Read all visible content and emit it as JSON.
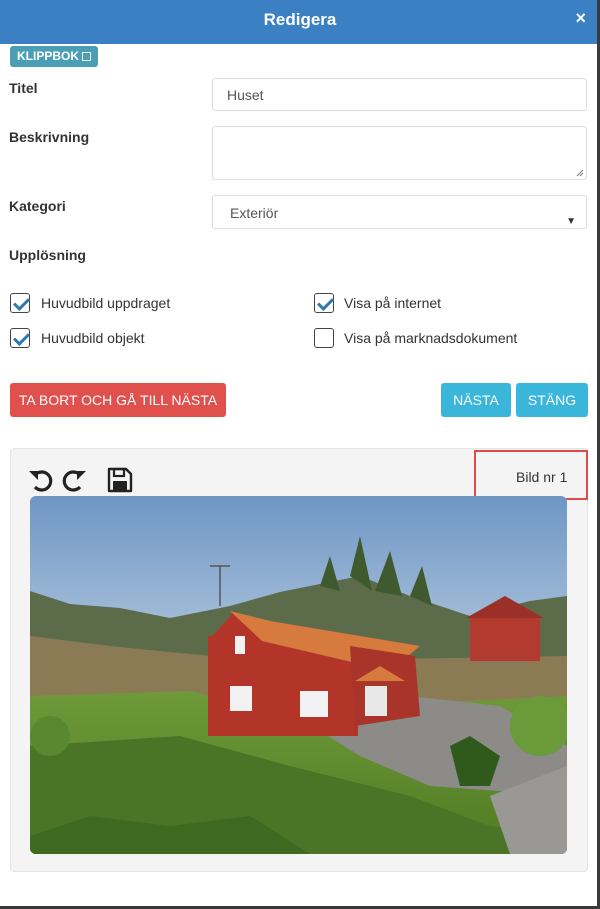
{
  "dialog": {
    "title": "Redigera",
    "close_symbol": "×"
  },
  "klippbok": {
    "label": "KLIPPBOK",
    "icon": "book-icon"
  },
  "form": {
    "titel": {
      "label": "Titel",
      "value": "Huset"
    },
    "beskrivning": {
      "label": "Beskrivning",
      "value": ""
    },
    "kategori": {
      "label": "Kategori",
      "selected": "Exteriör"
    },
    "upplosning": {
      "label": "Upplösning"
    }
  },
  "checkboxes": {
    "huvudbild_uppdraget": {
      "label": "Huvudbild uppdraget",
      "checked": true
    },
    "visa_internet": {
      "label": "Visa på internet",
      "checked": true
    },
    "huvudbild_objekt": {
      "label": "Huvudbild objekt",
      "checked": true
    },
    "visa_marknadsdokument": {
      "label": "Visa på marknadsdokument",
      "checked": false
    }
  },
  "buttons": {
    "delete_next": "TA BORT OCH GÅ TILL NÄSTA",
    "next": "NÄSTA",
    "close": "STÄNG"
  },
  "image_panel": {
    "tools": [
      "rotate-left-icon",
      "rotate-right-icon",
      "save-icon"
    ],
    "bild_nr": "Bild nr 1"
  },
  "colors": {
    "header": "#3a80c3",
    "klippbok": "#4a9fb5",
    "danger": "#e0504c",
    "info": "#3ab6db",
    "highlight": "#e04a4a",
    "checkmark": "#2f79b3"
  }
}
